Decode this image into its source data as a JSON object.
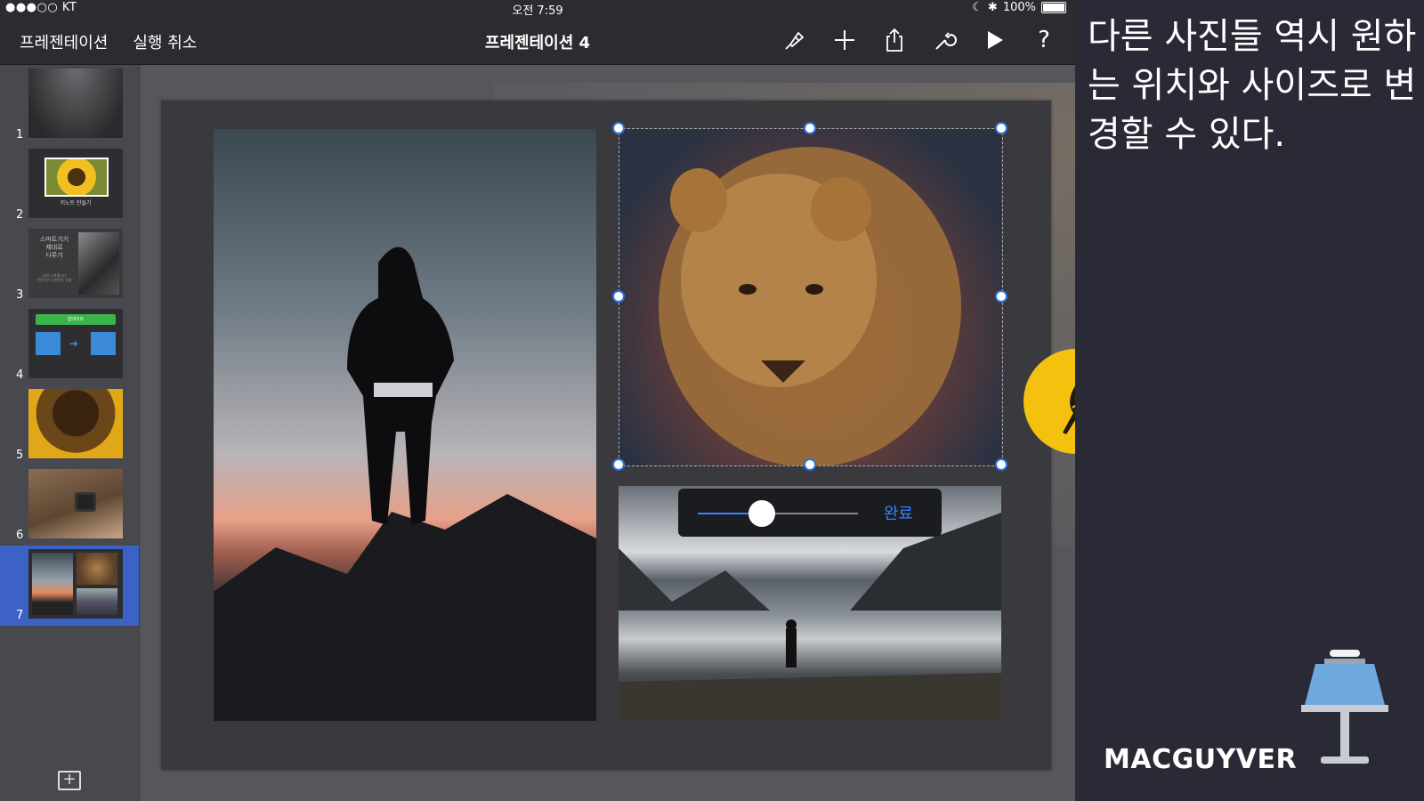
{
  "status_bar": {
    "carrier": "●●●○○ KT",
    "time": "오전 7:59",
    "battery": "100%"
  },
  "toolbar": {
    "presentations_label": "프레젠테이션",
    "undo_label": "실행 취소",
    "title": "프레젠테이션 4",
    "icons": [
      "paintbrush-icon",
      "plus-icon",
      "share-icon",
      "wrench-icon",
      "play-icon",
      "help-icon"
    ],
    "help_label": "?"
  },
  "sidebar": {
    "slides": [
      {
        "number": "1",
        "kind": "gradient"
      },
      {
        "number": "2",
        "kind": "sunflower-card",
        "caption": "키노트 만들기"
      },
      {
        "number": "3",
        "kind": "text-phone",
        "lines": [
          "스마트기기",
          "제대로",
          "다루기"
        ],
        "sub": "공개 소개합니다\n전문가가 추천하는 방법"
      },
      {
        "number": "4",
        "kind": "diagram",
        "banner": "업데이트"
      },
      {
        "number": "5",
        "kind": "sunflower-photo"
      },
      {
        "number": "6",
        "kind": "watch-photo"
      },
      {
        "number": "7",
        "kind": "collage",
        "active": true
      }
    ],
    "add_slide_label": "+"
  },
  "opacity_popover": {
    "value": 0.4,
    "done_label": "완료"
  },
  "side_panel": {
    "caption": "다른 사진들 역시 원하는 위치와 사이즈로 변경할 수 있다.",
    "brand": "MACGUYVER"
  },
  "colors": {
    "accent": "#2f86ff",
    "selection": "#3b62c4",
    "badge": "#f4c10f",
    "keynote_blue": "#6ea8dc"
  }
}
